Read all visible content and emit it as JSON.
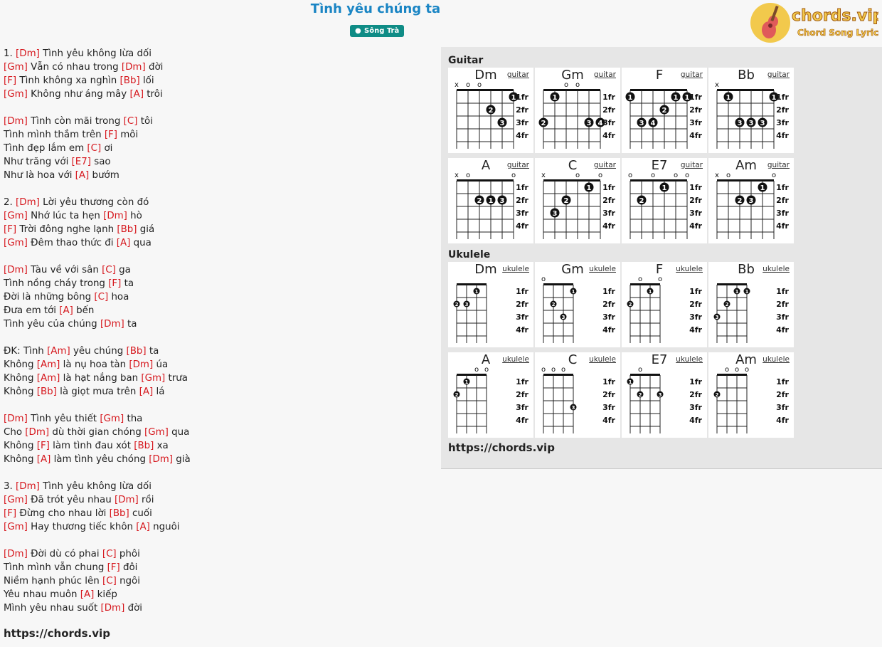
{
  "title": "Tình yêu chúng ta",
  "artist": "Sông Trà",
  "logo": {
    "brand": "chords.vip",
    "tagline": "Chord Song Lyric"
  },
  "lyrics": [
    [
      {
        "t": "1. "
      },
      {
        "c": "[Dm]"
      },
      {
        "t": " Tình yêu không lừa dối"
      }
    ],
    [
      {
        "c": "[Gm]"
      },
      {
        "t": " Vẫn có nhau trong "
      },
      {
        "c": "[Dm]"
      },
      {
        "t": " đời"
      }
    ],
    [
      {
        "c": "[F]"
      },
      {
        "t": " Tình không xa nghìn "
      },
      {
        "c": "[Bb]"
      },
      {
        "t": " lối"
      }
    ],
    [
      {
        "c": "[Gm]"
      },
      {
        "t": " Không như áng mây "
      },
      {
        "c": "[A]"
      },
      {
        "t": " trôi"
      }
    ],
    [],
    [
      {
        "c": "[Dm]"
      },
      {
        "t": " Tình còn mãi trong "
      },
      {
        "c": "[C]"
      },
      {
        "t": " tôi"
      }
    ],
    [
      {
        "t": "Tình mình thắm trên "
      },
      {
        "c": "[F]"
      },
      {
        "t": " môi"
      }
    ],
    [
      {
        "t": "Tình đẹp lắm em "
      },
      {
        "c": "[C]"
      },
      {
        "t": " ơi"
      }
    ],
    [
      {
        "t": "Như trăng với "
      },
      {
        "c": "[E7]"
      },
      {
        "t": " sao"
      }
    ],
    [
      {
        "t": "Như là hoa với "
      },
      {
        "c": "[A]"
      },
      {
        "t": " bướm"
      }
    ],
    [],
    [
      {
        "t": "2. "
      },
      {
        "c": "[Dm]"
      },
      {
        "t": " Lời yêu thương còn đó"
      }
    ],
    [
      {
        "c": "[Gm]"
      },
      {
        "t": " Nhớ lúc ta hẹn "
      },
      {
        "c": "[Dm]"
      },
      {
        "t": " hò"
      }
    ],
    [
      {
        "c": "[F]"
      },
      {
        "t": " Trời đông nghe lạnh "
      },
      {
        "c": "[Bb]"
      },
      {
        "t": " giá"
      }
    ],
    [
      {
        "c": "[Gm]"
      },
      {
        "t": " Đêm thao thức đi "
      },
      {
        "c": "[A]"
      },
      {
        "t": " qua"
      }
    ],
    [],
    [
      {
        "c": "[Dm]"
      },
      {
        "t": " Tàu về với sân "
      },
      {
        "c": "[C]"
      },
      {
        "t": " ga"
      }
    ],
    [
      {
        "t": "Tình nồng cháy trong "
      },
      {
        "c": "[F]"
      },
      {
        "t": " ta"
      }
    ],
    [
      {
        "t": "Đời là những bông "
      },
      {
        "c": "[C]"
      },
      {
        "t": " hoa"
      }
    ],
    [
      {
        "t": "Đưa em tới "
      },
      {
        "c": "[A]"
      },
      {
        "t": " bến"
      }
    ],
    [
      {
        "t": "Tình yêu của chúng "
      },
      {
        "c": "[Dm]"
      },
      {
        "t": " ta"
      }
    ],
    [],
    [
      {
        "t": "ĐK: Tình "
      },
      {
        "c": "[Am]"
      },
      {
        "t": " yêu chúng "
      },
      {
        "c": "[Bb]"
      },
      {
        "t": " ta"
      }
    ],
    [
      {
        "t": "Không "
      },
      {
        "c": "[Am]"
      },
      {
        "t": " là nụ hoa tàn "
      },
      {
        "c": "[Dm]"
      },
      {
        "t": " úa"
      }
    ],
    [
      {
        "t": "Không "
      },
      {
        "c": "[Am]"
      },
      {
        "t": " là hạt nắng ban "
      },
      {
        "c": "[Gm]"
      },
      {
        "t": " trưa"
      }
    ],
    [
      {
        "t": "Không "
      },
      {
        "c": "[Bb]"
      },
      {
        "t": " là giọt mưa trên "
      },
      {
        "c": "[A]"
      },
      {
        "t": " lá"
      }
    ],
    [],
    [
      {
        "c": "[Dm]"
      },
      {
        "t": " Tình yêu thiết "
      },
      {
        "c": "[Gm]"
      },
      {
        "t": " tha"
      }
    ],
    [
      {
        "t": "Cho "
      },
      {
        "c": "[Dm]"
      },
      {
        "t": " dù thời gian chóng "
      },
      {
        "c": "[Gm]"
      },
      {
        "t": " qua"
      }
    ],
    [
      {
        "t": "Không "
      },
      {
        "c": "[F]"
      },
      {
        "t": " làm tình đau xót "
      },
      {
        "c": "[Bb]"
      },
      {
        "t": " xa"
      }
    ],
    [
      {
        "t": "Không "
      },
      {
        "c": "[A]"
      },
      {
        "t": " làm tình yêu chóng "
      },
      {
        "c": "[Dm]"
      },
      {
        "t": " già"
      }
    ],
    [],
    [
      {
        "t": "3. "
      },
      {
        "c": "[Dm]"
      },
      {
        "t": " Tình yêu không lừa dối"
      }
    ],
    [
      {
        "c": "[Gm]"
      },
      {
        "t": " Đã trót yêu nhau "
      },
      {
        "c": "[Dm]"
      },
      {
        "t": " rồi"
      }
    ],
    [
      {
        "c": "[F]"
      },
      {
        "t": " Đừng cho nhau lời "
      },
      {
        "c": "[Bb]"
      },
      {
        "t": " cuối"
      }
    ],
    [
      {
        "c": "[Gm]"
      },
      {
        "t": " Hay thương tiếc khôn "
      },
      {
        "c": "[A]"
      },
      {
        "t": " nguôi"
      }
    ],
    [],
    [
      {
        "c": "[Dm]"
      },
      {
        "t": " Đời dù có phai "
      },
      {
        "c": "[C]"
      },
      {
        "t": " phôi"
      }
    ],
    [
      {
        "t": "Tình mình vẫn chung "
      },
      {
        "c": "[F]"
      },
      {
        "t": " đôi"
      }
    ],
    [
      {
        "t": "Niềm hạnh phúc lên "
      },
      {
        "c": "[C]"
      },
      {
        "t": " ngôi"
      }
    ],
    [
      {
        "t": "Yêu nhau muôn "
      },
      {
        "c": "[A]"
      },
      {
        "t": " kiếp"
      }
    ],
    [
      {
        "t": "Mình yêu nhau suốt "
      },
      {
        "c": "[Dm]"
      },
      {
        "t": " đời"
      }
    ]
  ],
  "lyrics_footer": "https://chords.vip",
  "panel": {
    "guitar_label": "Guitar",
    "ukulele_label": "Ukulele",
    "footer": "https://chords.vip",
    "fret_labels": [
      "1fr",
      "2fr",
      "3fr",
      "4fr"
    ],
    "guitar_link": "guitar",
    "ukulele_link": "ukulele",
    "guitar": [
      {
        "name": "Dm",
        "top": [
          "x",
          "o",
          "o",
          "",
          "",
          ""
        ],
        "dots": [
          [
            5,
            1,
            "1"
          ],
          [
            3,
            2,
            "2"
          ],
          [
            4,
            3,
            "3"
          ]
        ]
      },
      {
        "name": "Gm",
        "top": [
          "",
          "",
          "o",
          "o",
          "",
          ""
        ],
        "dots": [
          [
            1,
            1,
            "1"
          ],
          [
            0,
            3,
            "2"
          ],
          [
            4,
            3,
            "3"
          ],
          [
            5,
            3,
            "4"
          ]
        ]
      },
      {
        "name": "F",
        "top": [
          "",
          "",
          "",
          "",
          "",
          ""
        ],
        "dots": [
          [
            0,
            1,
            "1"
          ],
          [
            4,
            1,
            "1"
          ],
          [
            5,
            1,
            "1"
          ],
          [
            3,
            2,
            "2"
          ],
          [
            1,
            3,
            "3"
          ],
          [
            2,
            3,
            "4"
          ]
        ]
      },
      {
        "name": "Bb",
        "top": [
          "x",
          "",
          "",
          "",
          "",
          ""
        ],
        "dots": [
          [
            1,
            1,
            "1"
          ],
          [
            5,
            1,
            "1"
          ],
          [
            2,
            3,
            "3"
          ],
          [
            3,
            3,
            "3"
          ],
          [
            4,
            3,
            "3"
          ]
        ]
      },
      {
        "name": "A",
        "top": [
          "x",
          "o",
          "",
          "",
          "",
          "o"
        ],
        "dots": [
          [
            2,
            2,
            "2"
          ],
          [
            3,
            2,
            "1"
          ],
          [
            4,
            2,
            "3"
          ]
        ]
      },
      {
        "name": "C",
        "top": [
          "x",
          "",
          "",
          "o",
          "",
          "o"
        ],
        "dots": [
          [
            4,
            1,
            "1"
          ],
          [
            2,
            2,
            "2"
          ],
          [
            1,
            3,
            "3"
          ]
        ]
      },
      {
        "name": "E7",
        "top": [
          "o",
          "",
          "o",
          "",
          "o",
          "o"
        ],
        "dots": [
          [
            3,
            1,
            "1"
          ],
          [
            1,
            2,
            "2"
          ]
        ]
      },
      {
        "name": "Am",
        "top": [
          "x",
          "o",
          "",
          "",
          "",
          "o"
        ],
        "dots": [
          [
            4,
            1,
            "1"
          ],
          [
            2,
            2,
            "2"
          ],
          [
            3,
            2,
            "3"
          ]
        ]
      }
    ],
    "ukulele": [
      {
        "name": "Dm",
        "top": [
          "",
          "",
          "",
          ""
        ],
        "dots": [
          [
            2,
            1,
            "1"
          ],
          [
            0,
            2,
            "2"
          ],
          [
            1,
            2,
            "3"
          ]
        ]
      },
      {
        "name": "Gm",
        "top": [
          "o",
          "",
          "",
          ""
        ],
        "dots": [
          [
            3,
            1,
            "1"
          ],
          [
            1,
            2,
            "2"
          ],
          [
            2,
            3,
            "3"
          ]
        ]
      },
      {
        "name": "F",
        "top": [
          "",
          "o",
          "",
          "o"
        ],
        "dots": [
          [
            2,
            1,
            "1"
          ],
          [
            0,
            2,
            "2"
          ]
        ]
      },
      {
        "name": "Bb",
        "top": [
          "",
          "",
          "",
          ""
        ],
        "dots": [
          [
            2,
            1,
            "1"
          ],
          [
            3,
            1,
            "1"
          ],
          [
            1,
            2,
            "2"
          ],
          [
            0,
            3,
            "3"
          ]
        ]
      },
      {
        "name": "A",
        "top": [
          "",
          "",
          "o",
          "o"
        ],
        "dots": [
          [
            1,
            1,
            "1"
          ],
          [
            0,
            2,
            "2"
          ]
        ]
      },
      {
        "name": "C",
        "top": [
          "o",
          "o",
          "o",
          ""
        ],
        "dots": [
          [
            3,
            3,
            "3"
          ]
        ]
      },
      {
        "name": "E7",
        "top": [
          "",
          "o",
          "",
          ""
        ],
        "dots": [
          [
            0,
            1,
            "1"
          ],
          [
            1,
            2,
            "2"
          ],
          [
            3,
            2,
            "3"
          ]
        ]
      },
      {
        "name": "Am",
        "top": [
          "",
          "o",
          "o",
          "o"
        ],
        "dots": [
          [
            0,
            2,
            "2"
          ]
        ]
      }
    ]
  }
}
